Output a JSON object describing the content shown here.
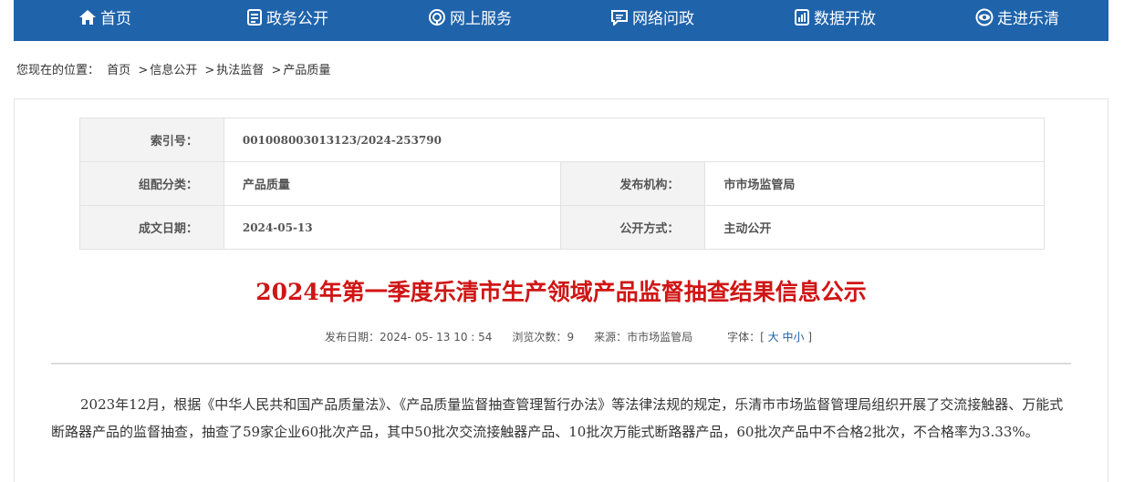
{
  "nav": {
    "items": [
      {
        "label": "首页",
        "icon": "home-icon"
      },
      {
        "label": "政务公开",
        "icon": "document-icon"
      },
      {
        "label": "网上服务",
        "icon": "service-icon"
      },
      {
        "label": "网络问政",
        "icon": "chat-icon"
      },
      {
        "label": "数据开放",
        "icon": "data-icon"
      },
      {
        "label": "走进乐清",
        "icon": "eye-icon"
      }
    ],
    "color": "#1f63ab"
  },
  "breadcrumb": {
    "prefix": "您现在的位置：",
    "items": [
      "首页",
      "信息公开",
      "执法监督",
      "产品质量"
    ],
    "separator": ">"
  },
  "meta": {
    "index_label": "索引号：",
    "index_value": "001008003013123/2024-253790",
    "category_label": "组配分类：",
    "category_value": "产品质量",
    "publisher_label": "发布机构：",
    "publisher_value": "市市场监管局",
    "date_label": "成文日期：",
    "date_value": "2024-05-13",
    "open_label": "公开方式：",
    "open_value": "主动公开"
  },
  "article": {
    "title": "2024年第一季度乐清市生产领域产品监督抽查结果信息公示",
    "title_color": "#d01515",
    "publish_label": "发布日期：",
    "publish_value": "2024- 05- 13 10 : 54",
    "views_label": "浏览次数：",
    "views_value": "9",
    "source_label": "来源：",
    "source_value": "市市场监管局",
    "font_label": "字体：",
    "font_open": "[",
    "font_large": "大",
    "font_medium": "中",
    "font_small": "小",
    "font_close": "]",
    "paragraph": "2023年12月，根据《中华人民共和国产品质量法》、《产品质量监督抽查管理暂行办法》等法律法规的规定，乐清市市场监督管理局组织开展了交流接触器、万能式断路器产品的监督抽查，抽查了59家企业60批次产品，其中50批次交流接触器产品、10批次万能式断路器产品，60批次产品中不合格2批次，不合格率为3.33%。"
  }
}
